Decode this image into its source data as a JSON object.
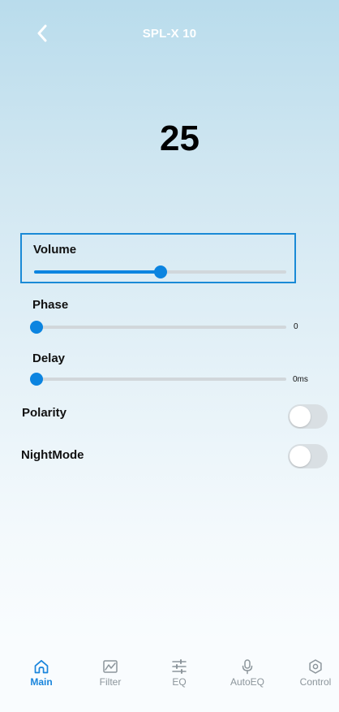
{
  "header": {
    "title": "SPL-X 10",
    "back_icon": "chevron-left-icon"
  },
  "display": {
    "value": "25"
  },
  "controls": {
    "volume": {
      "label": "Volume",
      "level": 0.5
    },
    "phase": {
      "label": "Phase",
      "level": 0,
      "value_text": "0"
    },
    "delay": {
      "label": "Delay",
      "level": 0,
      "value_text": "0ms"
    },
    "polarity": {
      "label": "Polarity",
      "on": false
    },
    "nightmode": {
      "label": "NightMode",
      "on": false
    }
  },
  "tabs": [
    {
      "label": "Main",
      "icon": "home-icon",
      "active": true
    },
    {
      "label": "Filter",
      "icon": "filter-graph-icon",
      "active": false
    },
    {
      "label": "EQ",
      "icon": "equalizer-sliders-icon",
      "active": false
    },
    {
      "label": "AutoEQ",
      "icon": "microphone-icon",
      "active": false
    },
    {
      "label": "Control",
      "icon": "hexagon-settings-icon",
      "active": false
    }
  ],
  "colors": {
    "accent": "#0b84e0",
    "active_tab": "#1a85dc",
    "inactive_tab": "#8c959b",
    "highlight_border": "#1a8ad6"
  }
}
